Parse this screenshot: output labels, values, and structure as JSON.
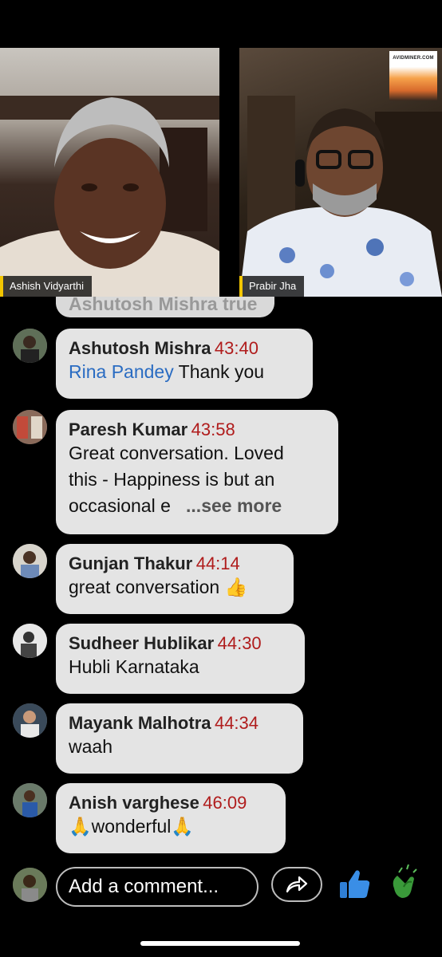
{
  "video": {
    "left_speaker": "Ashish Vidyarthi",
    "right_speaker": "Prabir Jha",
    "logo_text": "AVIDMINER.COM",
    "accent": "#f2c500"
  },
  "partial_comment_text": "Ashutosh Mishra true",
  "comments": [
    {
      "name": "Ashutosh Mishra",
      "time": "43:40",
      "mention": "Rina Pandey",
      "text": " Thank you"
    },
    {
      "name": "Paresh Kumar",
      "time": "43:58",
      "line1": "Great conversation. Loved",
      "line2": "this - Happiness is but an",
      "line3": "occasional e",
      "see_more": "...see more"
    },
    {
      "name": "Gunjan Thakur",
      "time": "44:14",
      "text": "great conversation 👍"
    },
    {
      "name": "Sudheer Hublikar",
      "time": "44:30",
      "text": "Hubli Karnataka"
    },
    {
      "name": "Mayank Malhotra",
      "time": "44:34",
      "text": "waah"
    },
    {
      "name": "Anish varghese",
      "time": "46:09",
      "text": "🙏wonderful🙏"
    }
  ],
  "composer": {
    "placeholder": "Add a comment...",
    "share_icon": "share-arrow-icon",
    "like_icon": "thumbs-up-icon",
    "clap_icon": "clapping-hands-icon"
  },
  "colors": {
    "timestamp": "#b01c1c",
    "mention": "#2a6cc2",
    "bubble": "#e4e4e4",
    "like": "#2f7fd6",
    "clap": "#3a9a3a"
  }
}
